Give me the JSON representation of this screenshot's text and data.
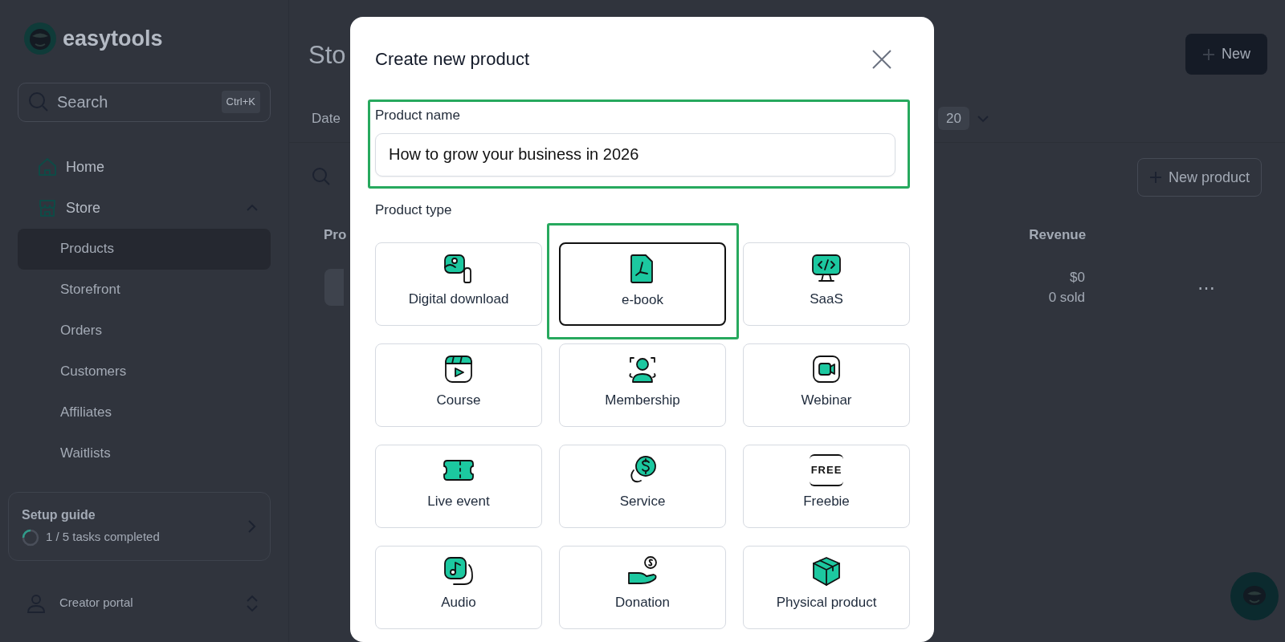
{
  "sidebar": {
    "brand": "easytools",
    "search": {
      "placeholder": "Search",
      "shortcut": "Ctrl+K"
    },
    "nav": [
      {
        "label": "Home",
        "selected": false
      },
      {
        "label": "Store",
        "selected": false,
        "expanded": true,
        "children": [
          {
            "label": "Products",
            "selected": true
          },
          {
            "label": "Storefront",
            "selected": false
          },
          {
            "label": "Orders",
            "selected": false
          },
          {
            "label": "Customers",
            "selected": false
          },
          {
            "label": "Affiliates",
            "selected": false
          },
          {
            "label": "Waitlists",
            "selected": false
          }
        ]
      }
    ],
    "setup_guide": {
      "title": "Setup guide",
      "progress": "1 / 5 tasks completed"
    },
    "account": {
      "label": "Creator portal"
    }
  },
  "page": {
    "title": "Sto",
    "new_button": "New",
    "filter_label": "Date",
    "filter_value": "20",
    "new_product_button": "New product",
    "columns": [
      "Pro",
      "Revenue"
    ],
    "rows": [
      {
        "revenue": "$0",
        "sold": "0 sold",
        "menu": "⋯"
      }
    ]
  },
  "dialog": {
    "title": "Create new product",
    "name_label": "Product name",
    "name_value": "How to grow your business in 2026",
    "name_highlighted": true,
    "type_label": "Product type",
    "type_rows": [
      [
        {
          "label": "Digital download",
          "selected": false,
          "highlighted": false
        },
        {
          "label": "e-book",
          "selected": true,
          "highlighted": true
        },
        {
          "label": "SaaS",
          "selected": false,
          "highlighted": false
        }
      ],
      [
        {
          "label": "Course",
          "selected": false,
          "highlighted": false
        },
        {
          "label": "Membership",
          "selected": false,
          "highlighted": false
        },
        {
          "label": "Webinar",
          "selected": false,
          "highlighted": false
        }
      ],
      [
        {
          "label": "Live event",
          "selected": false,
          "highlighted": false
        },
        {
          "label": "Service",
          "selected": false,
          "highlighted": false
        },
        {
          "label": "Freebie",
          "selected": false,
          "highlighted": false,
          "badge": "FREE"
        }
      ],
      [
        {
          "label": "Audio",
          "selected": false,
          "highlighted": false
        },
        {
          "label": "Donation",
          "selected": false,
          "highlighted": false
        },
        {
          "label": "Physical product",
          "selected": false,
          "highlighted": false
        }
      ]
    ]
  }
}
